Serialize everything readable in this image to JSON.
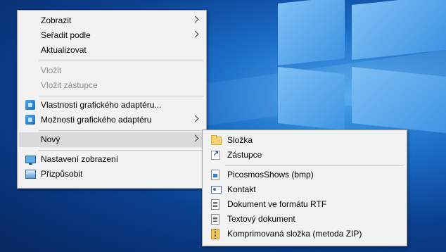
{
  "main_menu": {
    "items": [
      {
        "label": "Zobrazit",
        "has_submenu": true
      },
      {
        "label": "Seřadit podle",
        "has_submenu": true
      },
      {
        "label": "Aktualizovat"
      },
      {
        "label": "Vložit",
        "disabled": true
      },
      {
        "label": "Vložit zástupce",
        "disabled": true
      },
      {
        "label": "Vlastnosti grafického adaptéru...",
        "icon": "graphics-adapter-icon"
      },
      {
        "label": "Možnosti grafického adaptéru",
        "icon": "graphics-adapter-icon",
        "has_submenu": true
      },
      {
        "label": "Nový",
        "has_submenu": true,
        "highlighted": true
      },
      {
        "label": "Nastavení zobrazení",
        "icon": "display-settings-icon"
      },
      {
        "label": "Přizpůsobit",
        "icon": "personalize-icon"
      }
    ]
  },
  "new_submenu": {
    "items": [
      {
        "label": "Složka",
        "icon": "folder-icon"
      },
      {
        "label": "Zástupce",
        "icon": "shortcut-icon"
      },
      {
        "label": "PicosmosShows (bmp)",
        "icon": "bitmap-icon"
      },
      {
        "label": "Kontakt",
        "icon": "contact-icon"
      },
      {
        "label": "Dokument ve formátu RTF",
        "icon": "rtf-document-icon"
      },
      {
        "label": "Textový dokument",
        "icon": "text-document-icon"
      },
      {
        "label": "Komprimovaná složka (metoda ZIP)",
        "icon": "zip-folder-icon"
      }
    ]
  },
  "colors": {
    "menu_bg": "#f2f2f2",
    "highlight": "#dadada",
    "disabled_text": "#8d8d8d",
    "desktop_blue": "#0b3f8f"
  }
}
